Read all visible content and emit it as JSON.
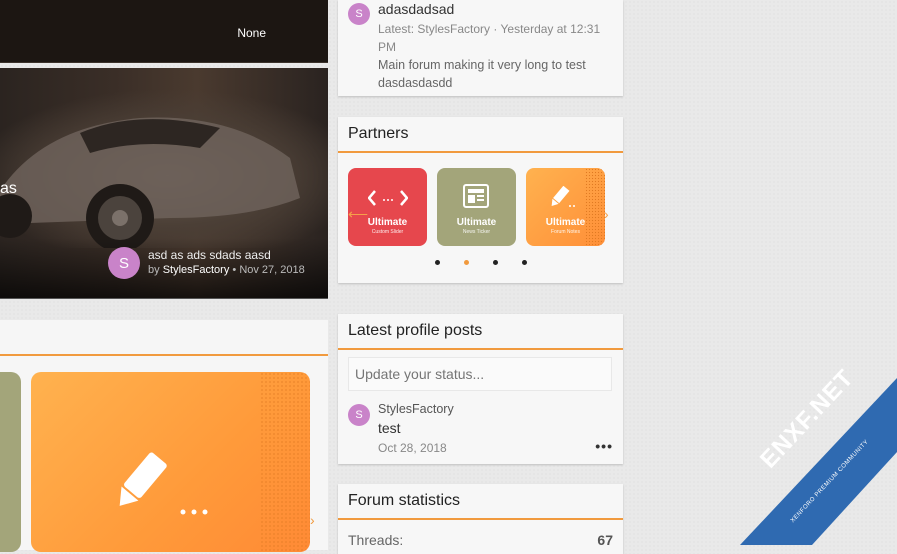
{
  "left_top": {
    "none_label": "None"
  },
  "slider": {
    "title_fragment": "as",
    "thread_title": "asd as ads sdads aasd",
    "byline_prefix": "by",
    "author": "StylesFactory",
    "separator": "•",
    "date": "Nov 27, 2018",
    "avatar_letter": "S"
  },
  "new_posts": {
    "avatar_letter": "S",
    "title": "adasdadsad",
    "latest": "Latest: StylesFactory · Yesterday at 12:31 PM",
    "snippet": "Main forum making it very long to test dasdasdasdd"
  },
  "partners": {
    "heading": "Partners",
    "cards": [
      {
        "title": "Ultimate",
        "subtitle": "Custom Slider",
        "color": "#e6474d",
        "icon": "code-icon"
      },
      {
        "title": "Ultimate",
        "subtitle": "News Ticker",
        "color": "#a3a57a",
        "icon": "newspaper-icon"
      },
      {
        "title": "Ultimate",
        "subtitle": "Forum Notes",
        "color": "#ff9a3a",
        "icon": "pencil-icon"
      }
    ],
    "pagination_count": 4,
    "active_page": 2
  },
  "profile_posts": {
    "heading": "Latest profile posts",
    "input_placeholder": "Update your status...",
    "author": "StylesFactory",
    "avatar_letter": "S",
    "text": "test",
    "date": "Oct 28, 2018",
    "more": "•••"
  },
  "forum_stats": {
    "heading": "Forum statistics",
    "threads_label": "Threads:",
    "threads_value": "67"
  },
  "watermark": {
    "brand": "ENXF.NET",
    "tagline": "XENFORO PREMIUM COMMUNITY",
    "color": "#2f6ab1"
  },
  "colors": {
    "accent": "#f19a3e",
    "avatar": "#c983c9"
  }
}
